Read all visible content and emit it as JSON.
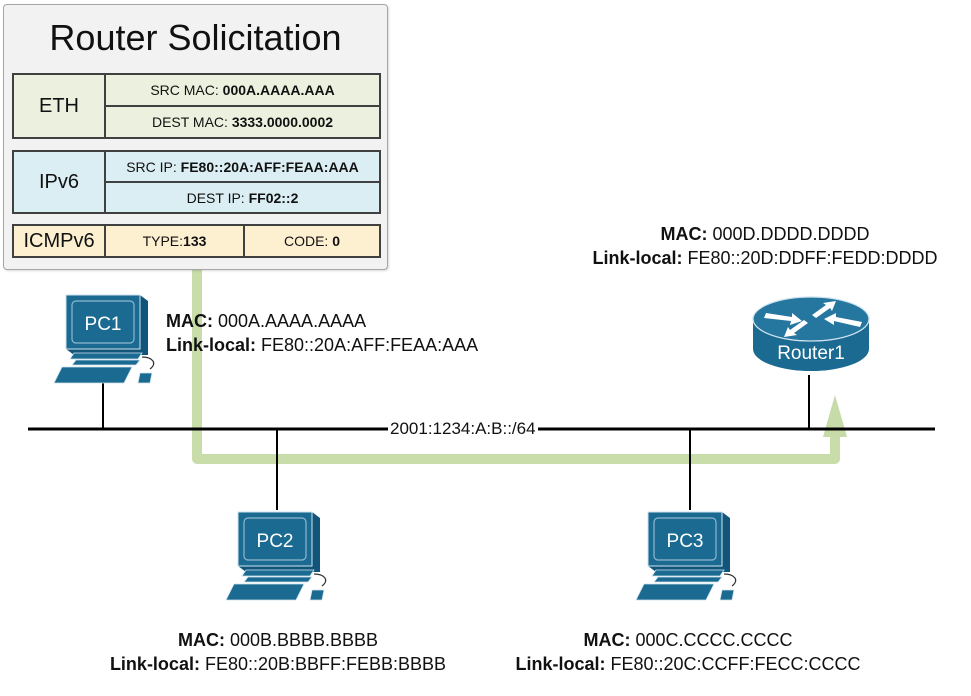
{
  "packet": {
    "title": "Router Solicitation",
    "eth": {
      "name": "ETH",
      "src_label": "SRC MAC: ",
      "src_value": "000A.AAAA.AAA",
      "dest_label": "DEST MAC: ",
      "dest_value": "3333.0000.0002"
    },
    "ipv6": {
      "name": "IPv6",
      "src_label": "SRC IP: ",
      "src_value": "FE80::20A:AFF:FEAA:AAA",
      "dest_label": "DEST IP: ",
      "dest_value": "FF02::2"
    },
    "icmpv6": {
      "name": "ICMPv6",
      "type_label": "TYPE:",
      "type_value": "133",
      "code_label": "CODE: ",
      "code_value": "0"
    }
  },
  "network": {
    "subnet": "2001:1234:A:B::/64"
  },
  "devices": {
    "pc1": {
      "name": "PC1",
      "mac_label": "MAC:",
      "mac": " 000A.AAAA.AAAA",
      "ll_label": "Link-local:",
      "ll": " FE80::20A:AFF:FEAA:AAA"
    },
    "pc2": {
      "name": "PC2",
      "mac_label": "MAC:",
      "mac": " 000B.BBBB.BBBB",
      "ll_label": "Link-local:",
      "ll": " FE80::20B:BBFF:FEBB:BBBB"
    },
    "pc3": {
      "name": "PC3",
      "mac_label": "MAC:",
      "mac": " 000C.CCCC.CCCC",
      "ll_label": "Link-local:",
      "ll": " FE80::20C:CCFF:FECC:CCCC"
    },
    "router1": {
      "name": "Router1",
      "mac_label": "MAC:",
      "mac": " 000D.DDDD.DDDD",
      "ll_label": "Link-local:",
      "ll": " FE80::20D:DDFF:FEDD:DDDD"
    }
  },
  "colors": {
    "device_blue": "#1b6a92",
    "path_green": "#c6dba7",
    "eth_bg": "#ebf1de",
    "ipv6_bg": "#dbeef4",
    "icmp_bg": "#fdf0d0"
  }
}
